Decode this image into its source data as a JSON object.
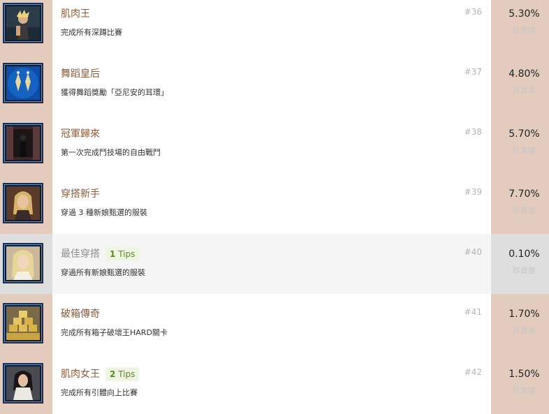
{
  "rarity_label": "珍貴度",
  "trophies": [
    {
      "num": "#36",
      "title": "肌肉王",
      "desc": "完成所有深蹲比賽",
      "percent": "5.30%",
      "icon": "muscle-king-trophy-icon",
      "earned": true
    },
    {
      "num": "#37",
      "title": "舞蹈皇后",
      "desc": "獲得舞蹈獎勵「亞尼安的耳環」",
      "percent": "4.80%",
      "icon": "dance-queen-earrings-trophy-icon",
      "earned": true
    },
    {
      "num": "#38",
      "title": "冠軍歸來",
      "desc": "第一次完成鬥技場的自由戰鬥",
      "percent": "5.70%",
      "icon": "champion-returns-trophy-icon",
      "earned": true
    },
    {
      "num": "#39",
      "title": "穿搭新手",
      "desc": "穿過 3 種新娘甄選的服裝",
      "percent": "7.70%",
      "icon": "outfit-novice-trophy-icon",
      "earned": true
    },
    {
      "num": "#40",
      "title": "最佳穿搭",
      "tips_count": "1",
      "tips_word": "Tips",
      "desc": "穿過所有新娘甄選的服裝",
      "percent": "0.10%",
      "icon": "best-outfit-trophy-icon",
      "earned": false
    },
    {
      "num": "#41",
      "title": "破箱傳奇",
      "desc": "完成所有箱子破壞王HARD關卡",
      "percent": "1.70%",
      "icon": "box-breaker-legend-trophy-icon",
      "earned": true
    },
    {
      "num": "#42",
      "title": "肌肉女王",
      "tips_count": "2",
      "tips_word": "Tips",
      "desc": "完成所有引體向上比賽",
      "percent": "1.50%",
      "icon": "muscle-queen-trophy-icon",
      "earned": true
    }
  ]
}
